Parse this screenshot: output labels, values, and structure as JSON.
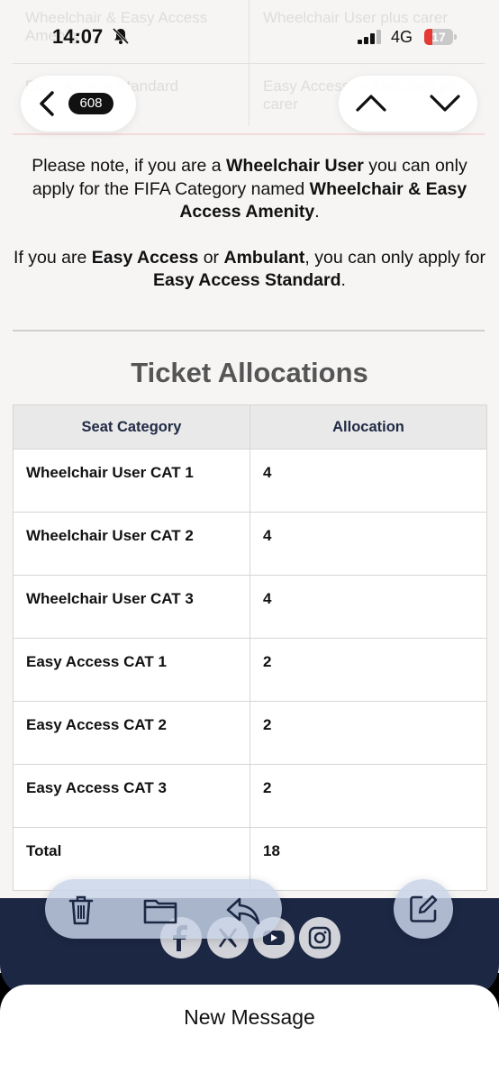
{
  "status": {
    "time": "14:07",
    "network": "4G",
    "battery": "17"
  },
  "ghost": {
    "r1c1": "Wheelchair & Easy Access Amenity",
    "r1c2": "Wheelchair User plus carer",
    "r2c1": "Easy Access Standard",
    "r2c2": "Easy Access or Ambulant plus carer"
  },
  "nav": {
    "unread_count": "608"
  },
  "note": {
    "p1_a": "Please note, if you are a ",
    "p1_b": "Wheelchair User",
    "p1_c": " you can only apply for the FIFA Category named ",
    "p1_d": "Wheelchair & Easy Access Amenity",
    "p1_e": ".",
    "p2_a": "If you are ",
    "p2_b": "Easy Access",
    "p2_c": " or ",
    "p2_d": "Ambulant",
    "p2_e": ", you can only apply for ",
    "p2_f": "Easy Access Standard",
    "p2_g": "."
  },
  "heading": "Ticket Allocations",
  "table": {
    "headers": [
      "Seat Category",
      "Allocation"
    ],
    "rows": [
      {
        "category": "Wheelchair User CAT 1",
        "allocation": "4"
      },
      {
        "category": "Wheelchair User CAT 2",
        "allocation": "4"
      },
      {
        "category": "Wheelchair User CAT 3",
        "allocation": "4"
      },
      {
        "category": "Easy Access CAT 1",
        "allocation": "2"
      },
      {
        "category": "Easy Access CAT 2",
        "allocation": "2"
      },
      {
        "category": "Easy Access CAT 3",
        "allocation": "2"
      },
      {
        "category": "Total",
        "allocation": "18"
      }
    ]
  },
  "icons": {
    "back": "chevron-left-icon",
    "up": "chevron-up-icon",
    "down": "chevron-down-icon",
    "trash": "trash-icon",
    "folder": "folder-icon",
    "reply": "reply-icon",
    "compose": "compose-icon",
    "social": [
      "facebook-icon",
      "x-icon",
      "youtube-icon",
      "instagram-icon"
    ]
  },
  "colors": {
    "footer": "#1c2744",
    "header_text": "#1f2a44",
    "battery_low": "#e53935"
  },
  "sheet": {
    "title": "New Message"
  }
}
